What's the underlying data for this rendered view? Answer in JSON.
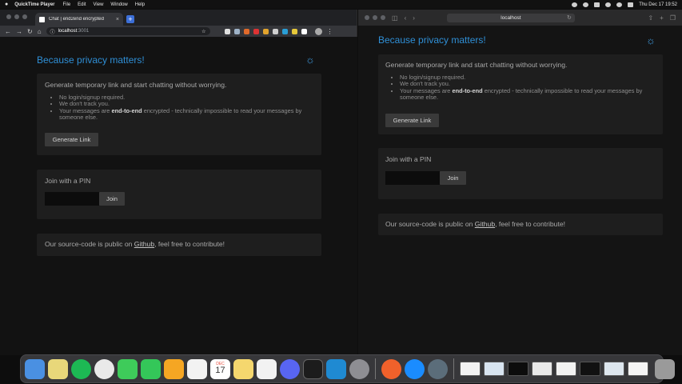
{
  "menubar": {
    "app": "QuickTime Player",
    "items": [
      "File",
      "Edit",
      "View",
      "Window",
      "Help"
    ],
    "clock": "Thu Dec 17  19:52"
  },
  "chrome": {
    "tab_title": "Chat | end2end encrypted",
    "url_host": "localhost",
    "url_port": ":3001",
    "extension_colors": [
      "#e0e0e0",
      "#9fb3c8",
      "#e06a2b",
      "#d33",
      "#e2a42d",
      "#cfcfcf",
      "#2a9fd6",
      "#e7c83a",
      "#ffffff"
    ]
  },
  "safari": {
    "url": "localhost"
  },
  "app": {
    "brand": "Because privacy matters!",
    "generate": {
      "lead": "Generate temporary link and start chatting without worrying.",
      "bullets": {
        "b1": "No login/signup required.",
        "b2": "We don't track you.",
        "b3_pre": "Your messages are ",
        "b3_strong": "end-to-end",
        "b3_post": " encrypted - technically impossible to read your messages by someone else."
      },
      "button": "Generate Link"
    },
    "join": {
      "heading": "Join with a PIN",
      "pin_value": "",
      "button": "Join"
    },
    "source": {
      "pre": "Our source-code is public on ",
      "link": "Github",
      "post": ", feel free to contribute!"
    }
  },
  "dock": {
    "calendar_month": "DEC",
    "calendar_day": "17",
    "app_colors": [
      "#4a90e2",
      "#e8d77a",
      "#1db954",
      "#e9e9e9",
      "#3ecb5a",
      "#34c759",
      "#f5a623",
      "#f2f2f2",
      "#e74c3c",
      "#f5d76e",
      "#f2f2f2",
      "#5865f2",
      "#1c1c1c",
      "#1f8ad2",
      "#8e8e93",
      "#f0612b",
      "#1a8cff",
      "#5b6d7a"
    ],
    "thumb_colors": [
      "#f2f2f2",
      "#d8e4f0",
      "#0c0c0c",
      "#e9e9e9",
      "#f2f2f2",
      "#111111",
      "#dde6ee",
      "#f4f4f4"
    ]
  }
}
